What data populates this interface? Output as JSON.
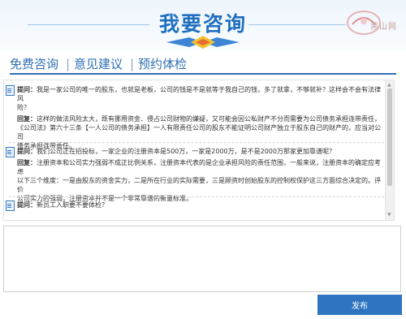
{
  "header": {
    "title": "我要咨询",
    "logo_text": "黑山网"
  },
  "tabs": [
    {
      "label": "免费咨询"
    },
    {
      "label": "意见建议"
    },
    {
      "label": "预约体检"
    }
  ],
  "tab_separator": "|",
  "qa": [
    {
      "q_label": "提问：",
      "q_lines": [
        "我是一家公司的唯一的股东，也就是老板，公司的钱是不是就等于我自己的钱，多了就拿，不够就补？这样会不会有法律风",
        "险？"
      ],
      "a_label": "回复：",
      "a_lines": [
        "这样的做法风险太大，既有挪用资金、侵占公司财物的嫌疑，又可能会因公私财产不分而需要为公司债务承担连带责任，",
        "《公司法》第六十三条【一人公司的债务承担】一人有限责任公司的股东不能证明公司财产独立于股东自己的财产的，应当对公司",
        "债务承担连带责任。"
      ]
    },
    {
      "q_label": "提问：",
      "q_lines": [
        "我们公司正在招投标，一家企业的注册资本是500万，一家是2000万，是不是2000万那家更加靠谱呢？"
      ],
      "a_label": "回复：",
      "a_lines": [
        "注册资本和公司实力强弱不成正比例关系，注册资本代表的是企业承担风险的责任范围，一般来说，注册资本的确定应考虑",
        "以下三个维度：一是由股东的资金实力，二是所在行业的实际需要，三是顾资时创始股东的控制权保护这三方面综合决定的。评价",
        "公司实力的强弱，注册资本并不是一个非常靠谱的衡量标准。"
      ]
    },
    {
      "q_label": "提问：",
      "q_lines": [
        "新员工入职要不要体检？"
      ]
    }
  ],
  "composer": {
    "placeholder": "",
    "value": ""
  },
  "send_button": {
    "label": "发布"
  },
  "colors": {
    "accent": "#2f74c1",
    "title": "#1f6fbf",
    "tab_text": "#2f6fb1"
  },
  "icons": {
    "question": "document-icon",
    "scroll_up": "triangle-up-icon",
    "scroll_down": "triangle-down-icon",
    "deco": "diamond-icon"
  }
}
